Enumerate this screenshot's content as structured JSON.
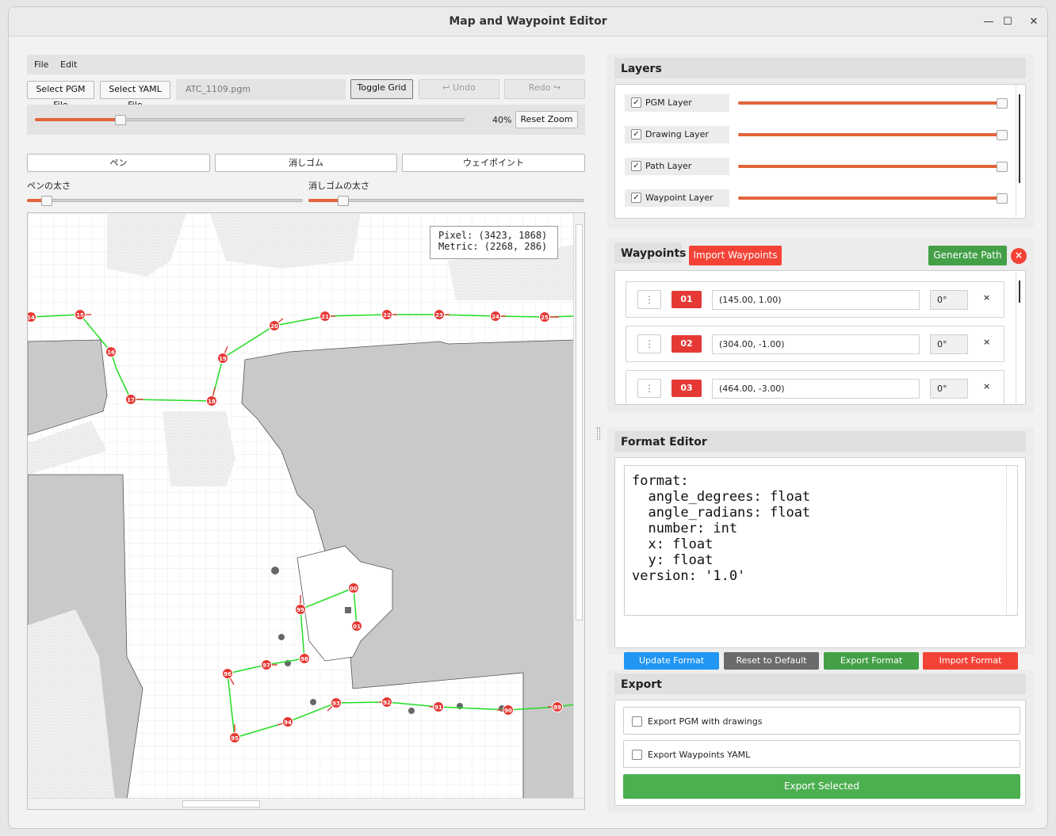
{
  "window": {
    "title": "Map and Waypoint Editor",
    "minimize": "—",
    "maximize": "☐",
    "close": "✕"
  },
  "menu": {
    "file": "File",
    "edit": "Edit"
  },
  "toolbar": {
    "select_pgm": "Select PGM File",
    "select_yaml": "Select YAML File",
    "file_name": "ATC_1109.pgm",
    "toggle_grid": "Toggle Grid",
    "undo": "↩ Undo",
    "redo": "Redo ↪"
  },
  "zoom": {
    "percent_label": "40%",
    "value": 0.4,
    "reset_label": "Reset Zoom"
  },
  "tools": {
    "pen": "ペン",
    "eraser": "消しゴム",
    "waypoint": "ウェイポイント"
  },
  "sliders": {
    "pen_size_label": "ペンの太さ",
    "pen_size_value": 0.05,
    "eraser_size_label": "消しゴムの太さ",
    "eraser_size_value": 0.12
  },
  "map": {
    "tooltip_pixel": "Pixel: (3423, 1868)",
    "tooltip_metric": "Metric: (2268, 286)",
    "waypoint_labels_upper": [
      "14",
      "15",
      "16",
      "17",
      "18",
      "19",
      "20",
      "21",
      "22",
      "23",
      "24",
      "25"
    ],
    "waypoint_labels_lower": [
      "00",
      "01",
      "99",
      "98",
      "97",
      "96",
      "95",
      "94",
      "93",
      "92",
      "91",
      "90",
      "89"
    ]
  },
  "layers": {
    "title": "Layers",
    "items": [
      {
        "name": "PGM Layer",
        "checked": true,
        "opacity": 1.0
      },
      {
        "name": "Drawing Layer",
        "checked": true,
        "opacity": 1.0
      },
      {
        "name": "Path Layer",
        "checked": true,
        "opacity": 1.0
      },
      {
        "name": "Waypoint Layer",
        "checked": true,
        "opacity": 1.0
      }
    ]
  },
  "waypoints": {
    "title": "Waypoints",
    "import_label": "Import Waypoints",
    "generate_label": "Generate Path",
    "clear_icon": "×",
    "items": [
      {
        "number": "01",
        "coord": "(145.00, 1.00)",
        "angle": "0°",
        "delete": "×",
        "drag": "⋮"
      },
      {
        "number": "02",
        "coord": "(304.00, -1.00)",
        "angle": "0°",
        "delete": "×",
        "drag": "⋮"
      },
      {
        "number": "03",
        "coord": "(464.00, -3.00)",
        "angle": "0°",
        "delete": "×",
        "drag": "⋮"
      }
    ]
  },
  "format_editor": {
    "title": "Format Editor",
    "lines": [
      "format:",
      "  angle_degrees: float",
      "  angle_radians: float",
      "  number: int",
      "  x: float",
      "  y: float",
      "version: '1.0'"
    ],
    "update_label": "Update Format",
    "reset_label": "Reset to Default",
    "export_label": "Export Format",
    "import_label": "Import Format"
  },
  "export": {
    "title": "Export",
    "pgm_option": "Export PGM with drawings",
    "yaml_option": "Export Waypoints YAML",
    "button": "Export Selected"
  },
  "colors": {
    "accent_red": "#e53935",
    "slider_orange": "#e2643a",
    "blue": "#2196f3",
    "gray": "#666666",
    "green": "#4caf50",
    "path_green": "#22dd22"
  }
}
